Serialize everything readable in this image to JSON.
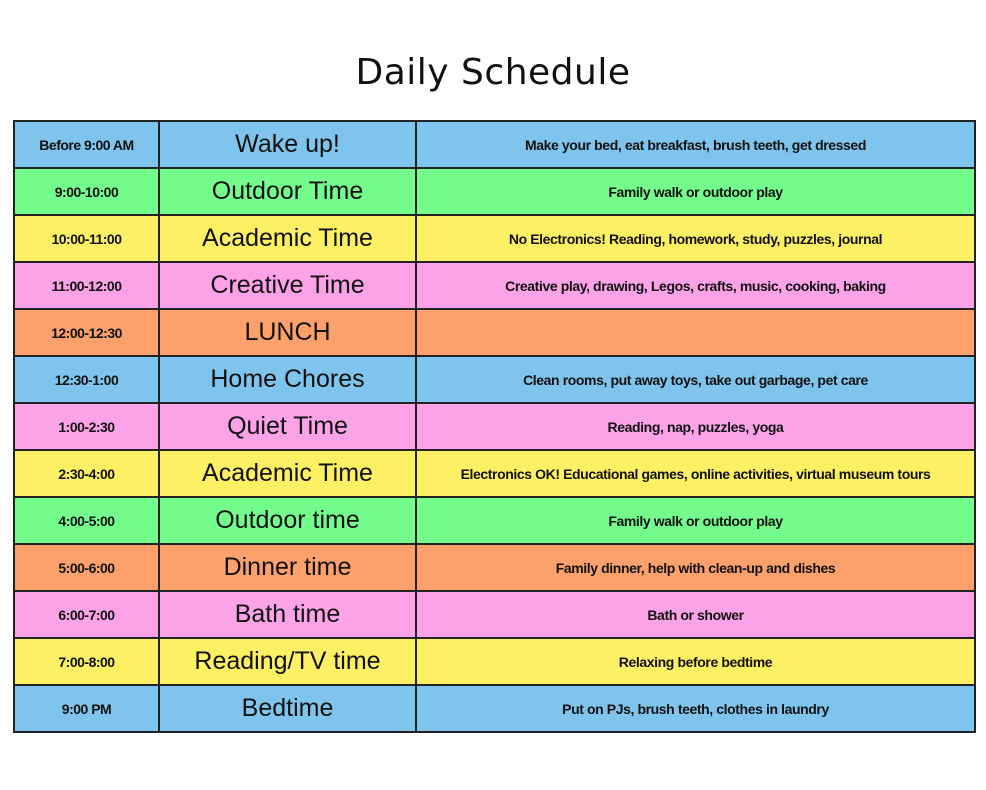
{
  "title": "Daily Schedule",
  "colors": {
    "blue": "#7fc4ec",
    "green": "#74fc8c",
    "yellow": "#fdf064",
    "pink": "#fca3e8",
    "orange": "#fca06c"
  },
  "schedule": {
    "rows": [
      {
        "time": "Before 9:00 AM",
        "activity": "Wake up!",
        "details": "Make your bed, eat breakfast, brush teeth, get dressed",
        "color": "blue"
      },
      {
        "time": "9:00-10:00",
        "activity": "Outdoor Time",
        "details": "Family walk or outdoor play",
        "color": "green"
      },
      {
        "time": "10:00-11:00",
        "activity": "Academic Time",
        "details": "No Electronics! Reading, homework, study, puzzles, journal",
        "color": "yellow"
      },
      {
        "time": "11:00-12:00",
        "activity": "Creative Time",
        "details": "Creative play, drawing, Legos, crafts, music, cooking, baking",
        "color": "pink"
      },
      {
        "time": "12:00-12:30",
        "activity": "LUNCH",
        "details": "",
        "color": "orange"
      },
      {
        "time": "12:30-1:00",
        "activity": "Home Chores",
        "details": "Clean rooms, put away toys, take out garbage, pet care",
        "color": "blue"
      },
      {
        "time": "1:00-2:30",
        "activity": "Quiet Time",
        "details": "Reading, nap, puzzles, yoga",
        "color": "pink"
      },
      {
        "time": "2:30-4:00",
        "activity": "Academic Time",
        "details": "Electronics OK! Educational games, online activities, virtual museum tours",
        "color": "yellow"
      },
      {
        "time": "4:00-5:00",
        "activity": "Outdoor time",
        "details": "Family walk or outdoor play",
        "color": "green"
      },
      {
        "time": "5:00-6:00",
        "activity": "Dinner time",
        "details": "Family dinner, help with clean-up and dishes",
        "color": "orange"
      },
      {
        "time": "6:00-7:00",
        "activity": "Bath time",
        "details": "Bath or shower",
        "color": "pink"
      },
      {
        "time": "7:00-8:00",
        "activity": "Reading/TV time",
        "details": "Relaxing before bedtime",
        "color": "yellow"
      },
      {
        "time": "9:00 PM",
        "activity": "Bedtime",
        "details": "Put on PJs, brush teeth, clothes in laundry",
        "color": "blue"
      }
    ]
  }
}
